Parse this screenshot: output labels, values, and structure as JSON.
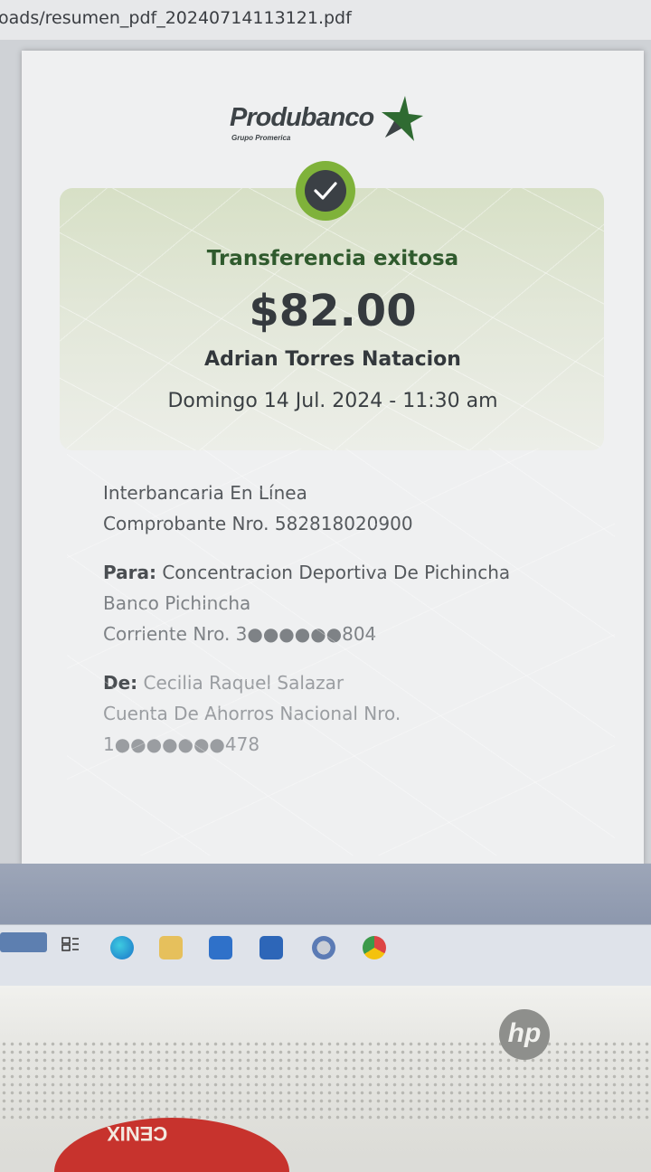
{
  "browser": {
    "url_text": "oads/resumen_pdf_20240714113121.pdf"
  },
  "logo": {
    "name": "Produbanco",
    "subtitle": "Grupo Promerica"
  },
  "receipt": {
    "status": "Transferencia exitosa",
    "amount": "$82.00",
    "recipient_name": "Adrian Torres Natacion",
    "datetime": "Domingo 14 Jul. 2024 - 11:30 am",
    "type": "Interbancaria En Línea",
    "voucher": "Comprobante Nro. 582818020900",
    "to_label": "Para:",
    "to_name": "Concentracion Deportiva De Pichincha",
    "to_bank": "Banco Pichincha",
    "to_account": "Corriente Nro. 3●●●●●●804",
    "from_label": "De:",
    "from_name": "Cecilia Raquel Salazar",
    "from_account_type": "Cuenta De Ahorros Nacional Nro.",
    "from_account": "1●●●●●●●478"
  },
  "monitor": {
    "brand": "hp",
    "sticker_text": "CENIX"
  },
  "colors": {
    "accent_green": "#7fb23a",
    "status_green": "#2f5a2d"
  },
  "icons": [
    "check-icon",
    "produbanco-star-icon",
    "taskview-icon",
    "edge-icon",
    "file-explorer-icon",
    "store-icon",
    "bank-app-icon",
    "refresh-app-icon",
    "chrome-icon"
  ]
}
